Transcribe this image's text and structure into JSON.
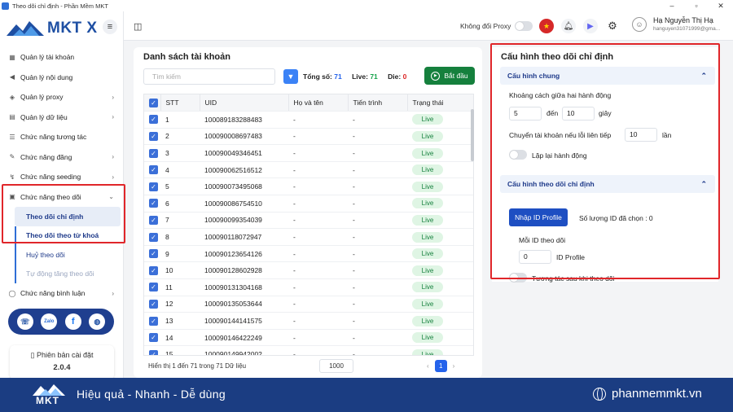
{
  "window": {
    "title": "Theo dõi chỉ định - Phần Mềm MKT"
  },
  "brand": {
    "logo_text": "MKT X"
  },
  "sidebar": {
    "items": [
      {
        "label": "Quản lý tài khoản",
        "icon": "grid-icon",
        "chevron": ""
      },
      {
        "label": "Quản lý nội dung",
        "icon": "megaphone-icon",
        "chevron": ""
      },
      {
        "label": "Quản lý proxy",
        "icon": "shield-icon",
        "chevron": "›"
      },
      {
        "label": "Quản lý dữ liệu",
        "icon": "database-icon",
        "chevron": "›"
      },
      {
        "label": "Chức năng tương tác",
        "icon": "list-icon",
        "chevron": ""
      },
      {
        "label": "Chức năng đăng",
        "icon": "edit-icon",
        "chevron": "›"
      },
      {
        "label": "Chức năng seeding",
        "icon": "seed-icon",
        "chevron": "›"
      },
      {
        "label": "Chức năng theo dõi",
        "icon": "follow-icon",
        "chevron": "⌄"
      }
    ],
    "subitems": [
      {
        "label": "Theo dõi chỉ định"
      },
      {
        "label": "Theo dõi theo từ khoá"
      },
      {
        "label": "Huỷ theo dõi"
      },
      {
        "label": "Tự động tăng theo dõi"
      }
    ],
    "last_item": {
      "label": "Chức năng bình luận",
      "chevron": "›"
    },
    "social": [
      "hotline-icon",
      "zalo-icon",
      "facebook-icon",
      "globe-icon"
    ],
    "social_labels": {
      "zalo": "Zalo",
      "facebook": "f"
    },
    "version": {
      "label": "Phiên bản cài đặt",
      "number": "2.0.4"
    }
  },
  "topbar": {
    "proxy_label": "Không đổi Proxy",
    "user_name": "Hạ Nguyễn Thị Hạ",
    "user_email": "hanguyen31071999@gma..."
  },
  "accounts": {
    "title": "Danh sách tài khoản",
    "search_placeholder": "Tìm kiếm",
    "total_label": "Tổng số:",
    "total": "71",
    "live_label": "Live:",
    "live": "71",
    "die_label": "Die:",
    "die": "0",
    "start_label": "Bắt đầu",
    "columns": [
      "STT",
      "UID",
      "Họ và tên",
      "Tiến trình",
      "Trạng thái"
    ],
    "rows": [
      [
        "1",
        "100089183288483",
        "-",
        "-",
        "Live"
      ],
      [
        "2",
        "100090008697483",
        "-",
        "-",
        "Live"
      ],
      [
        "3",
        "100090049346451",
        "-",
        "-",
        "Live"
      ],
      [
        "4",
        "100090062516512",
        "-",
        "-",
        "Live"
      ],
      [
        "5",
        "100090073495068",
        "-",
        "-",
        "Live"
      ],
      [
        "6",
        "100090086754510",
        "-",
        "-",
        "Live"
      ],
      [
        "7",
        "100090099354039",
        "-",
        "-",
        "Live"
      ],
      [
        "8",
        "100090118072947",
        "-",
        "-",
        "Live"
      ],
      [
        "9",
        "100090123654126",
        "-",
        "-",
        "Live"
      ],
      [
        "10",
        "100090128602928",
        "-",
        "-",
        "Live"
      ],
      [
        "11",
        "100090131304168",
        "-",
        "-",
        "Live"
      ],
      [
        "12",
        "100090135053644",
        "-",
        "-",
        "Live"
      ],
      [
        "13",
        "100090144141575",
        "-",
        "-",
        "Live"
      ],
      [
        "14",
        "100090146422249",
        "-",
        "-",
        "Live"
      ],
      [
        "15",
        "100090149942002",
        "-",
        "-",
        "Live"
      ]
    ],
    "footer": "Hiển thị 1 đến 71 trong 71 Dữ liệu",
    "page_size": "1000",
    "page": "1",
    "prev": "‹",
    "next": "›"
  },
  "config": {
    "title": "Cấu hình theo dõi chỉ định",
    "general": {
      "header": "Cấu hình chung",
      "delay_label": "Khoảng cách giữa hai hành động",
      "delay_from": "5",
      "delay_to_label": "đến",
      "delay_to": "10",
      "delay_unit": "giây",
      "switch_label": "Chuyển tài khoản nếu lỗi liên tiếp",
      "switch_value": "10",
      "switch_unit": "lần",
      "repeat_label": "Lặp lại hành động"
    },
    "follow": {
      "header": "Cấu hình theo dõi chỉ định",
      "import_label": "Nhập ID Profile",
      "selected_label": "Số lượng ID đã chọn : 0",
      "per_label": "Mỗi ID theo dõi",
      "per_value": "0",
      "per_unit": "ID Profile",
      "interact_label": "Tương tác sau khi theo dõi"
    }
  },
  "banner": {
    "logo": "MKT",
    "slogan": "Hiệu quả - Nhanh - Dễ dùng",
    "website": "phanmemmkt.vn"
  },
  "colors": {
    "accent": "#2563eb",
    "brand": "#1b3d82",
    "highlight": "#e0262a",
    "live": "#15803d"
  }
}
